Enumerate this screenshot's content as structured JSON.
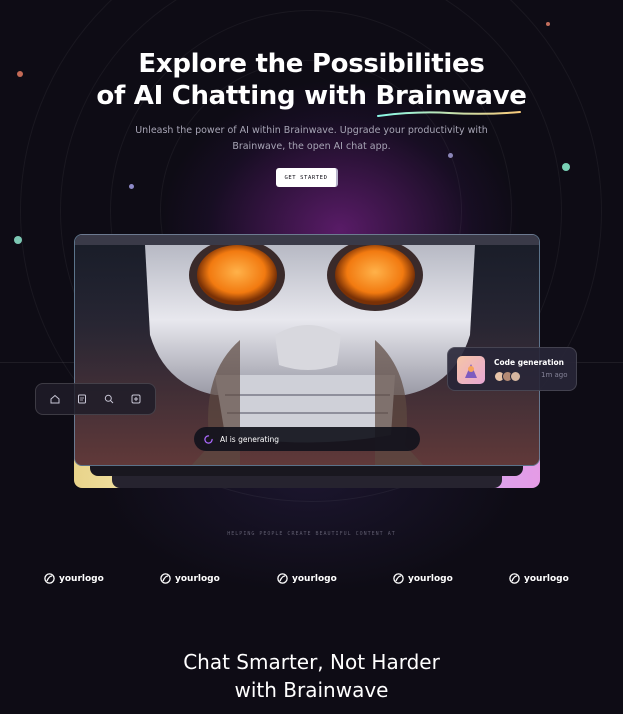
{
  "hero": {
    "title_line1": "Explore the Possibilities",
    "title_line2_prefix": "of AI Chatting with",
    "title_brand": "Brainwave",
    "subtitle": "Unleash the power of AI within Brainwave. Upgrade your productivity with Brainwave, the open AI chat app.",
    "cta_label": "GET STARTED"
  },
  "preview": {
    "toolbar": {
      "icons": [
        "home-icon",
        "document-icon",
        "search-icon",
        "add-square-icon"
      ]
    },
    "generating_text": "AI is generating",
    "card": {
      "title": "Code generation",
      "time": "1m ago"
    }
  },
  "logos_section": {
    "caption": "HELPING PEOPLE CREATE BEAUTIFUL CONTENT AT",
    "logos": [
      "yourlogo",
      "yourlogo",
      "yourlogo",
      "yourlogo",
      "yourlogo"
    ]
  },
  "features": {
    "heading_line1": "Chat Smarter, Not Harder",
    "heading_line2": "with Brainwave"
  },
  "colors": {
    "background": "#0e0c15",
    "accent_glow": "#9628aa",
    "brand_underline_start": "#89f9e8",
    "brand_underline_end": "#facb7b"
  }
}
